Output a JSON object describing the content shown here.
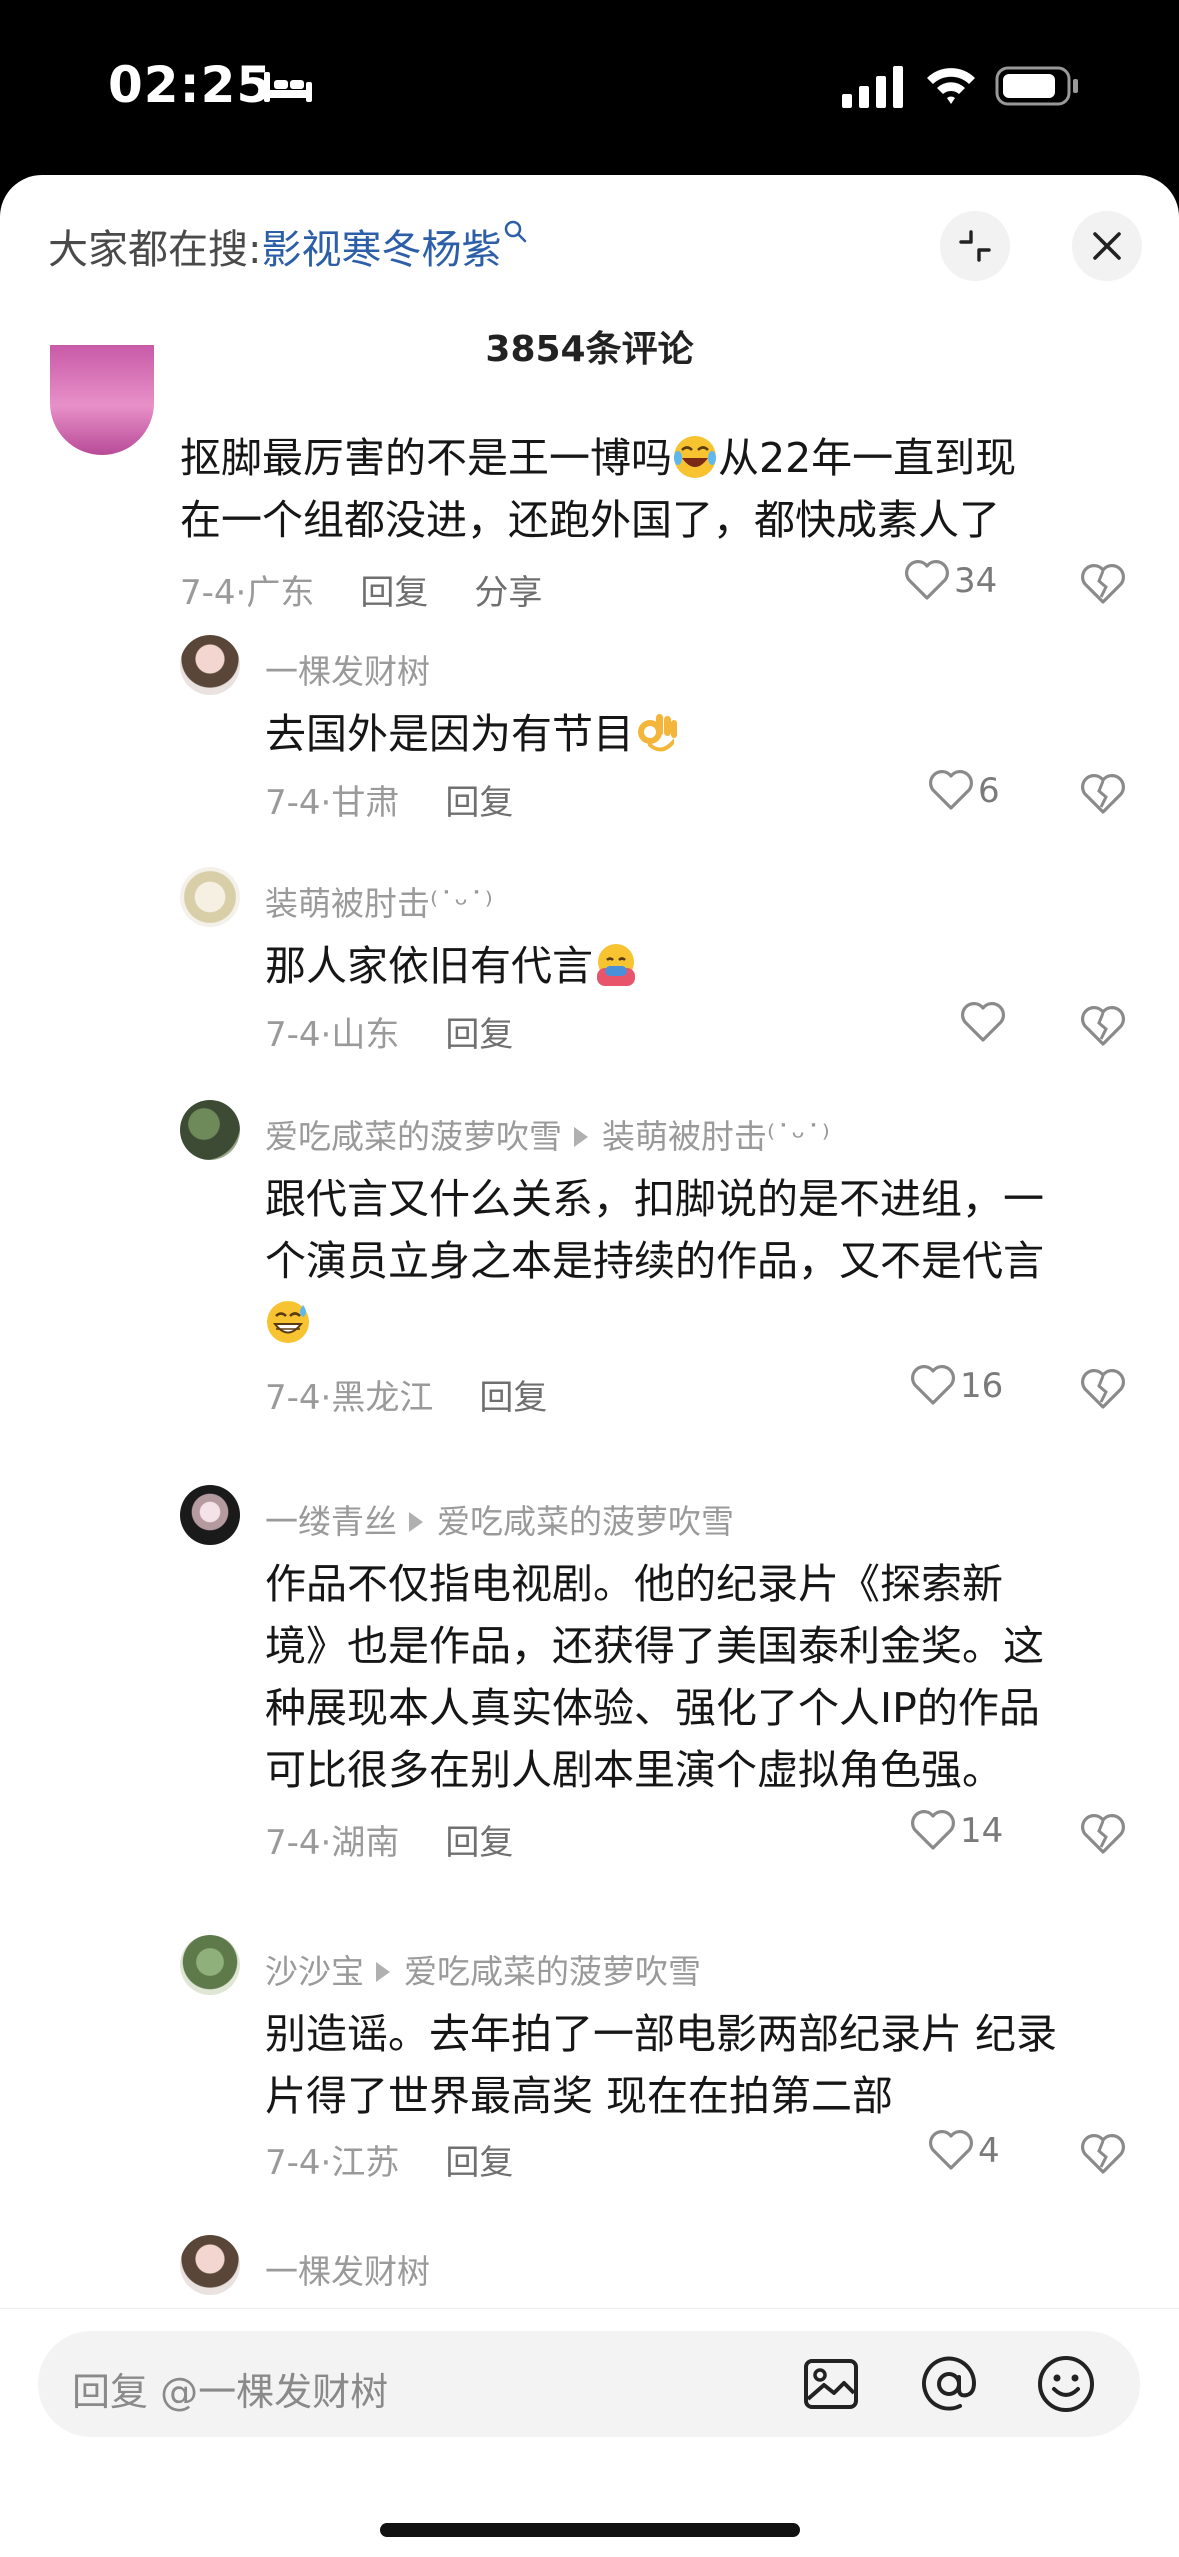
{
  "status": {
    "time": "02:25"
  },
  "header": {
    "search_prefix": "大家都在搜:",
    "search_term": "影视寒冬杨紫",
    "comment_count": "3854条评论"
  },
  "comments": [
    {
      "author": "",
      "body_lines": [
        "抠脚最厉害的不是王一博吗",
        "在一个组都没进，还跑外国了，都快成素人了"
      ],
      "body_after_emoji": "从22年一直到现",
      "meta": "7-4·广东",
      "reply": "回复",
      "share": "分享",
      "likes": "34"
    },
    {
      "author": "一棵发财树",
      "body_lines": [
        "去国外是因为有节目"
      ],
      "meta": "7-4·甘肃",
      "reply": "回复",
      "likes": "6"
    },
    {
      "author": "装萌被肘击⁽˙ᵕ˙⁾",
      "body_lines": [
        "那人家依旧有代言"
      ],
      "meta": "7-4·山东",
      "reply": "回复",
      "likes": ""
    },
    {
      "author": "爱吃咸菜的菠萝吹雪",
      "reply_to": "装萌被肘击⁽˙ᵕ˙⁾",
      "body_lines": [
        "跟代言又什么关系，扣脚说的是不进组，一",
        "个演员立身之本是持续的作品，又不是代言"
      ],
      "meta": "7-4·黑龙江",
      "reply": "回复",
      "likes": "16"
    },
    {
      "author": "一缕青丝",
      "reply_to": "爱吃咸菜的菠萝吹雪",
      "body_lines": [
        "作品不仅指电视剧。他的纪录片《探索新",
        "境》也是作品，还获得了美国泰利金奖。这",
        "种展现本人真实体验、强化了个人IP的作品",
        "可比很多在别人剧本里演个虚拟角色强。"
      ],
      "meta": "7-4·湖南",
      "reply": "回复",
      "likes": "14"
    },
    {
      "author": "沙沙宝",
      "reply_to": "爱吃咸菜的菠萝吹雪",
      "body_lines": [
        "别造谣。去年拍了一部电影两部纪录片 纪录",
        "片得了世界最高奖 现在在拍第二部"
      ],
      "meta": "7-4·江苏",
      "reply": "回复",
      "likes": "4"
    },
    {
      "author": "一棵发财树"
    }
  ],
  "footer": {
    "reply_placeholder": "回复 @一棵发财树"
  },
  "icons": {
    "sleep": "bed-icon",
    "signal": "cellular-signal-icon",
    "wifi": "wifi-icon",
    "battery": "battery-icon",
    "search": "search-icon",
    "collapse": "collapse-icon",
    "close": "close-icon",
    "like": "heart-icon",
    "dislike": "broken-heart-icon",
    "image": "image-icon",
    "mention": "at-icon",
    "emoji": "smiley-icon"
  },
  "colors": {
    "accent_link": "#2d5fa8",
    "muted_text": "#9a9a9a",
    "body_text": "#161616",
    "sheet_bg": "#ffffff"
  }
}
